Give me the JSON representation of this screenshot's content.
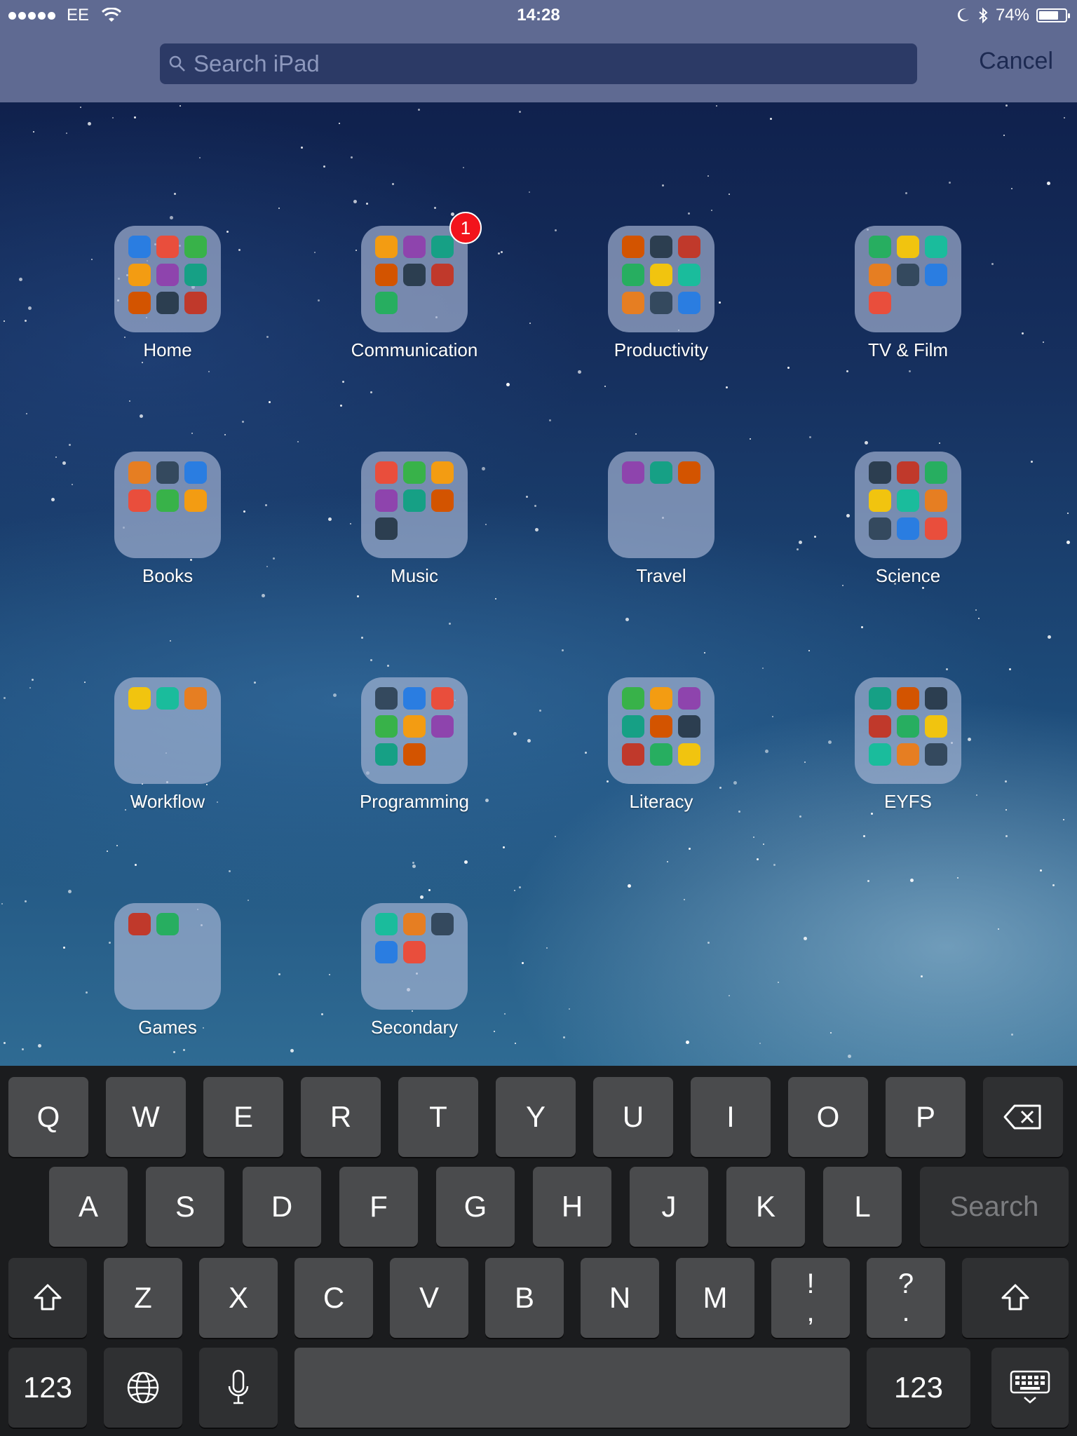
{
  "status_bar": {
    "carrier": "EE",
    "time": "14:28",
    "battery_percent": "74%",
    "battery_level": 0.74
  },
  "search": {
    "placeholder": "Search iPad",
    "cancel_label": "Cancel"
  },
  "folders": [
    {
      "label": "Home",
      "badge": "",
      "apps": [
        "green-ball-app",
        "ebay-app",
        "clock-app",
        "reminders-app",
        "photos-app",
        "family-app",
        "books-app",
        "tes-app",
        "etsy-app"
      ]
    },
    {
      "label": "Communication",
      "badge": "1",
      "apps": [
        "linkedin-app",
        "skype-app",
        "messages-app",
        "contacts-app",
        "find-friends-app",
        "facetime-app",
        "mail-app"
      ]
    },
    {
      "label": "Productivity",
      "badge": "",
      "apps": [
        "numbers-app",
        "pages-app",
        "keynote-app",
        "explain-app",
        "3d-app",
        "notes-app",
        "itunes-u-app",
        "toolbox-app",
        "board-app"
      ]
    },
    {
      "label": "TV & Film",
      "badge": "",
      "apps": [
        "tv-app",
        "itv-app",
        "iplayer-app",
        "clapper-app",
        "channel5-app",
        "youtube-app",
        "camera-app"
      ]
    },
    {
      "label": "Books",
      "badge": "",
      "apps": [
        "ibooks-app",
        "audiobook-app",
        "itunes-u-books-app",
        "kindle-app",
        "book-creator-app",
        "storybook-app"
      ]
    },
    {
      "label": "Music",
      "badge": "",
      "apps": [
        "garageband-app",
        "microphone-app",
        "itunes-app",
        "soundboard-app",
        "music-app",
        "sequencer-app",
        "rock-app"
      ]
    },
    {
      "label": "Travel",
      "badge": "",
      "apps": [
        "maps-app",
        "google-maps-app",
        "bbc-weather-app"
      ]
    },
    {
      "label": "Science",
      "badge": "",
      "apps": [
        "microscope-app",
        "robot-app",
        "skeleton-app",
        "atom-app",
        "compass-app",
        "wave-app",
        "flask-app",
        "paint-app",
        "u-app"
      ]
    },
    {
      "label": "Workflow",
      "badge": "",
      "apps": [
        "dropbox-app",
        "box-app",
        "google-drive-app"
      ]
    },
    {
      "label": "Programming",
      "badge": "",
      "apps": [
        "scratch-app",
        "hopscotch-app",
        "move-app",
        "daisy-app",
        "bee-bot-app",
        "game-app",
        "lightbot-app",
        "robot-bot-app"
      ]
    },
    {
      "label": "Literacy",
      "badge": "",
      "apps": [
        "j2e-app",
        "explain-app",
        "octopus-app",
        "smile-app",
        "tiny-tap-app",
        "pow-app",
        "comic-app",
        "clicker-app",
        "cake-app"
      ]
    },
    {
      "label": "EYFS",
      "badge": "",
      "apps": [
        "kids-app",
        "toast-app",
        "tree-app",
        "2simple-app",
        "superhero-app",
        "draw-app",
        "sea-app",
        "fire-app",
        "puzzle-app"
      ]
    },
    {
      "label": "Games",
      "badge": "",
      "apps": [
        "racer-app",
        "space-app"
      ]
    },
    {
      "label": "Secondary",
      "badge": "",
      "apps": [
        "bird-app",
        "nearpod-app",
        "evernote-app",
        "showbie-app",
        "tinker-app"
      ]
    }
  ],
  "keyboard": {
    "row1": [
      "Q",
      "W",
      "E",
      "R",
      "T",
      "Y",
      "U",
      "I",
      "O",
      "P"
    ],
    "row2": [
      "A",
      "S",
      "D",
      "F",
      "G",
      "H",
      "J",
      "K",
      "L"
    ],
    "search_label": "Search",
    "row3": [
      "Z",
      "X",
      "C",
      "V",
      "B",
      "N",
      "M"
    ],
    "punct1": {
      "top": "!",
      "bottom": ","
    },
    "punct2": {
      "top": "?",
      "bottom": "."
    },
    "numbers_label": "123"
  },
  "colors": {
    "topbar": "#5f6a92",
    "badge": "#f2131c",
    "key": "#4a4b4d",
    "key_dark": "#2f3032"
  }
}
